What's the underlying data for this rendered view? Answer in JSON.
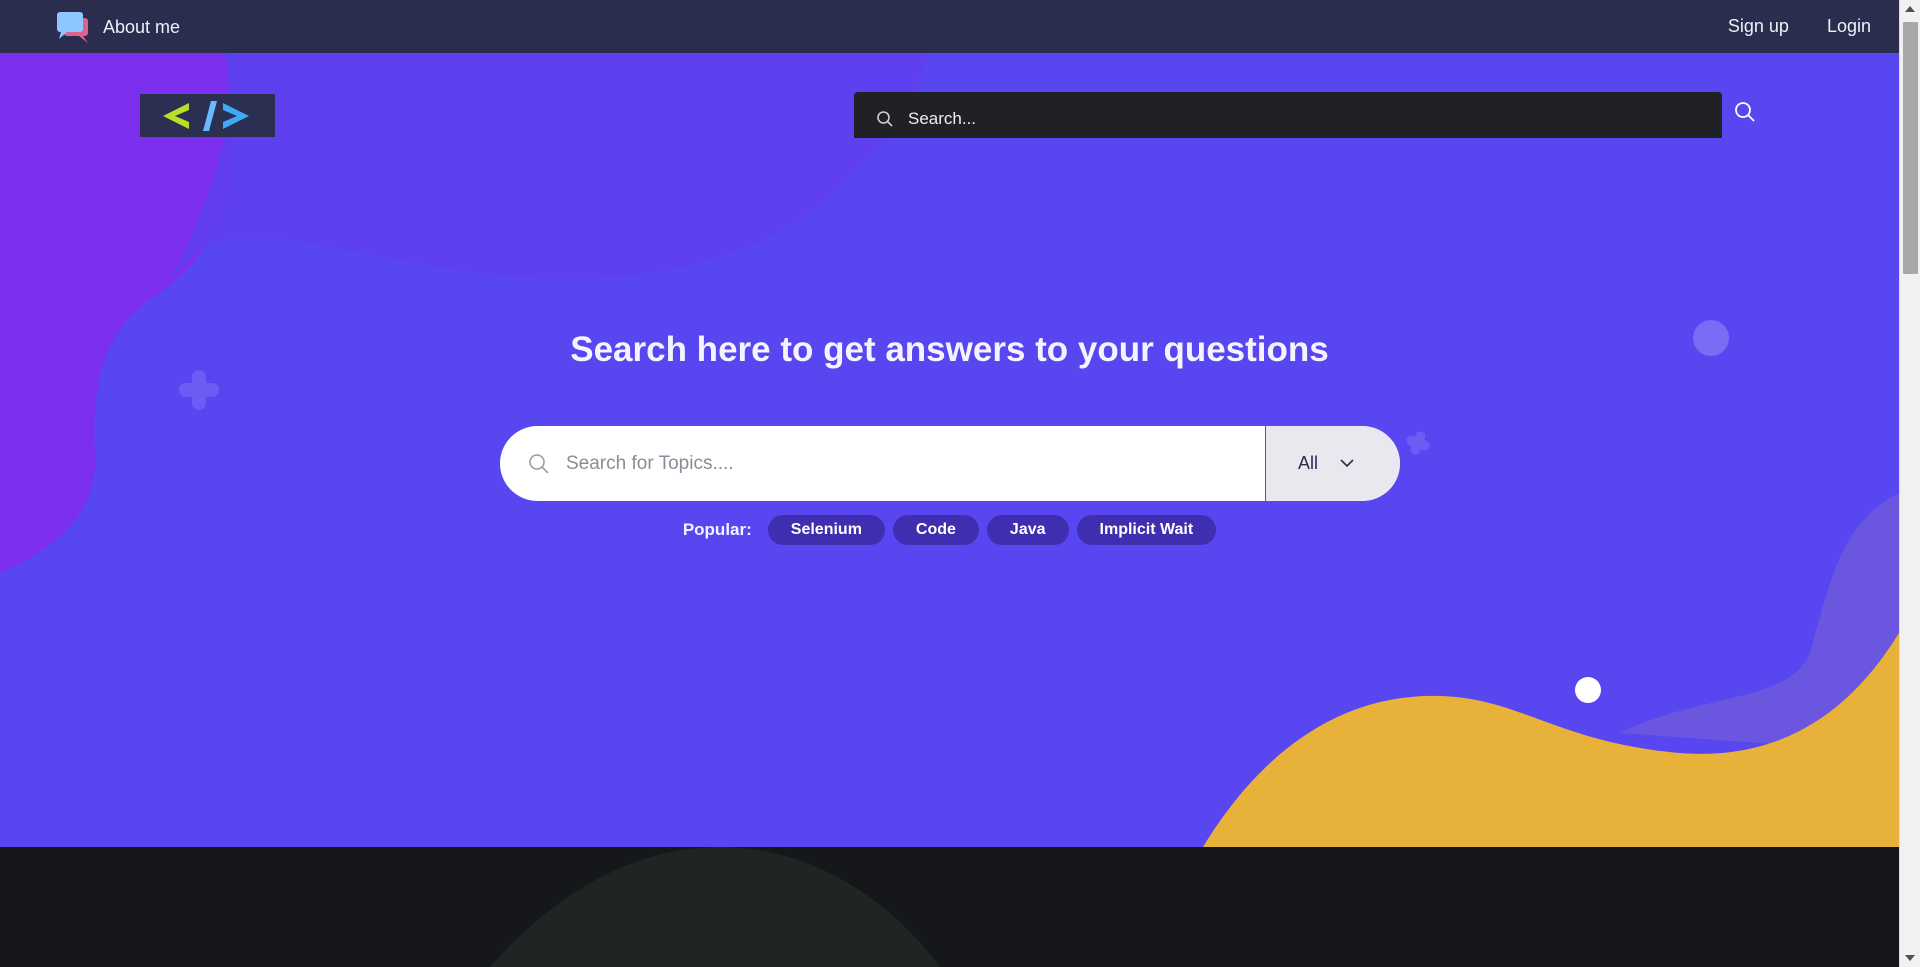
{
  "topbar": {
    "about_label": "About me",
    "signup_label": "Sign up",
    "login_label": "Login"
  },
  "header": {
    "logo_icon": "code-brackets-logo",
    "search_placeholder": "Search..."
  },
  "hero": {
    "title": "Search here to get answers to your questions",
    "search_placeholder": "Search for Topics....",
    "category_selected": "All",
    "popular_label": "Popular:",
    "popular_tags": [
      "Selenium",
      "Code",
      "Java",
      "Implicit Wait"
    ]
  },
  "colors": {
    "topbar": "#2a2d4d",
    "hero": "#5847f0",
    "accent_yellow": "#e8b23a",
    "tag_bg": "#3f2fb0",
    "footer": "#16171b"
  }
}
